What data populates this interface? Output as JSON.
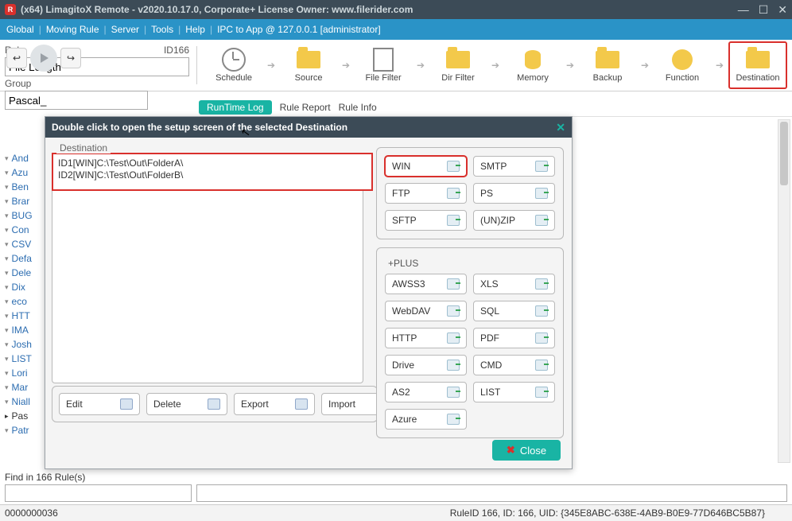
{
  "title": "(x64) LimagitoX Remote - v2020.10.17.0, Corporate+ License Owner: www.filerider.com",
  "menu": [
    "Global",
    "Moving Rule",
    "Server",
    "Tools",
    "Help",
    "IPC to App @ 127.0.0.1 [administrator]"
  ],
  "rule_label": "Rule",
  "rule_id_label": "ID166",
  "rule_value": "File Length",
  "group_label": "Group",
  "group_value": "Pascal_",
  "tools": [
    {
      "label": "Schedule"
    },
    {
      "label": "Source"
    },
    {
      "label": "File Filter"
    },
    {
      "label": "Dir Filter"
    },
    {
      "label": "Memory"
    },
    {
      "label": "Backup"
    },
    {
      "label": "Function"
    },
    {
      "label": "Destination"
    }
  ],
  "sub_tabs": {
    "runtime": "RunTime Log",
    "report": "Rule Report",
    "info": "Rule Info"
  },
  "rules": [
    "And",
    "Azu",
    "Ben",
    "Brar",
    "BUG",
    "Con",
    "CSV",
    "Defa",
    "Dele",
    "Dix",
    "eco",
    "HTT",
    "IMA",
    "Josh",
    "LIST",
    "Lori",
    "Mar",
    "Niall",
    "Pas",
    "Patr"
  ],
  "active_rule_index": 18,
  "find_label": "Find in 166 Rule(s)",
  "status": {
    "counter": "0000000036",
    "rule": "RuleID 166, ID: 166, UID: {345E8ABC-638E-4AB9-B0E9-77D646BC5B87}"
  },
  "modal": {
    "title": "Double click to open the setup screen of the selected Destination",
    "group_title": "Destination",
    "list": [
      "ID1[WIN]C:\\Test\\Out\\FolderA\\",
      "ID2[WIN]C:\\Test\\Out\\FolderB\\"
    ],
    "actions": {
      "edit": "Edit",
      "delete": "Delete",
      "export": "Export",
      "import": "Import"
    },
    "types_basic": [
      "WIN",
      "SMTP",
      "FTP",
      "PS",
      "SFTP",
      "(UN)ZIP"
    ],
    "plus_label": "+PLUS",
    "types_plus": [
      "AWSS3",
      "XLS",
      "WebDAV",
      "SQL",
      "HTTP",
      "PDF",
      "Drive",
      "CMD",
      "AS2",
      "LIST",
      "Azure"
    ],
    "close": "Close"
  }
}
